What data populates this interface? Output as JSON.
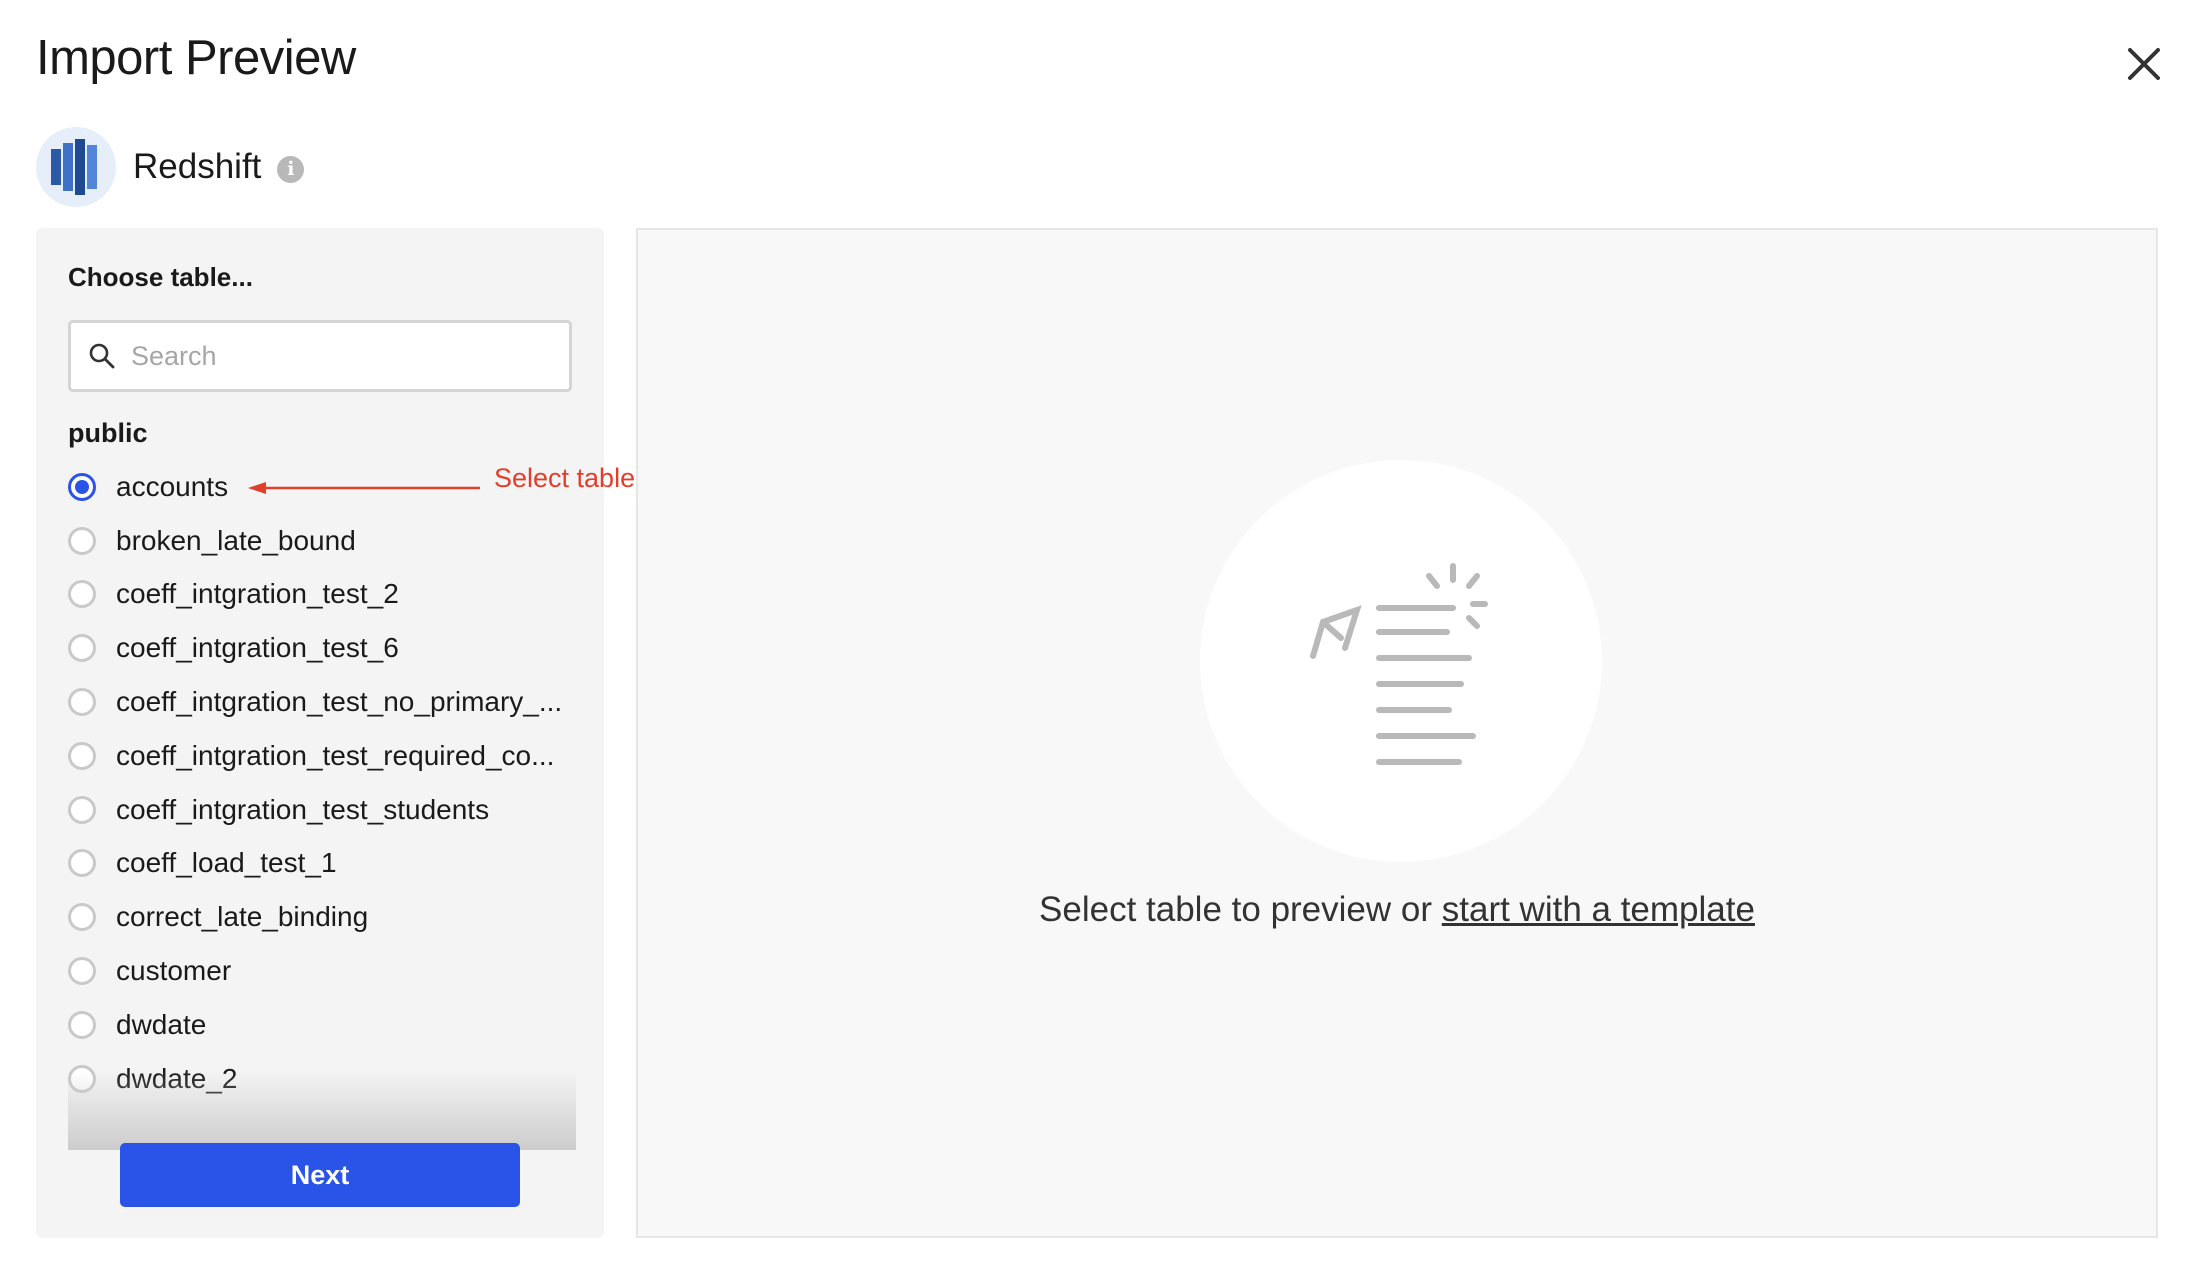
{
  "dialog": {
    "title": "Import Preview"
  },
  "source": {
    "name": "Redshift",
    "info_glyph": "i",
    "logo_icon": "redshift-logo-icon",
    "logo_color": "#2d5aa8"
  },
  "table_picker": {
    "heading": "Choose table...",
    "search_placeholder": "Search",
    "search_value": "",
    "schema": "public",
    "selected": "accounts",
    "items": [
      {
        "label": "accounts",
        "checked": true
      },
      {
        "label": "broken_late_bound",
        "checked": false
      },
      {
        "label": "coeff_intgration_test_2",
        "checked": false
      },
      {
        "label": "coeff_intgration_test_6",
        "checked": false
      },
      {
        "label": "coeff_intgration_test_no_primary_...",
        "checked": false
      },
      {
        "label": "coeff_intgration_test_required_co...",
        "checked": false
      },
      {
        "label": "coeff_intgration_test_students",
        "checked": false
      },
      {
        "label": "coeff_load_test_1",
        "checked": false
      },
      {
        "label": "correct_late_binding",
        "checked": false
      },
      {
        "label": "customer",
        "checked": false
      },
      {
        "label": "dwdate",
        "checked": false
      },
      {
        "label": "dwdate_2",
        "checked": false
      }
    ],
    "next_label": "Next"
  },
  "annotation": {
    "text": "Select table",
    "color": "#e0402b"
  },
  "preview": {
    "message_prefix": "Select table to preview or ",
    "template_link": "start with a template",
    "illustration_icon": "document-send-icon"
  },
  "colors": {
    "accent": "#2a54e8",
    "panel_bg": "#f4f4f4"
  }
}
